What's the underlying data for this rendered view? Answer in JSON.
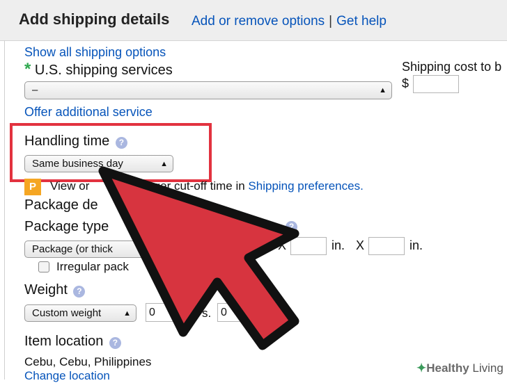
{
  "header": {
    "title": "Add shipping details",
    "link_add_remove": "Add or remove options",
    "separator": "|",
    "link_help": "Get help"
  },
  "shipping": {
    "show_all_link": "Show all shipping options",
    "required_marker": "*",
    "us_services_label": "U.S. shipping services",
    "service_select_value": "–",
    "offer_additional_link": "Offer additional service",
    "cost_label": "Shipping cost to b",
    "currency_symbol": "$"
  },
  "handling": {
    "label": "Handling time",
    "help_glyph": "?",
    "select_value": "Same business day"
  },
  "notice": {
    "badge": "P",
    "text_a": "View or",
    "text_b": "rger cut-off time in",
    "link": "Shipping preferences."
  },
  "package": {
    "details_label": "Package de",
    "type_label": "Package type",
    "type_select_value": "Package (or thick",
    "x1": "X",
    "unit1": "in.",
    "x2": "X",
    "unit2": "in.",
    "irregular_label": "Irregular pack"
  },
  "weight": {
    "label": "Weight",
    "select_value": "Custom weight",
    "field1_value": "0",
    "field2_value": "0",
    "unit_fragment": "s."
  },
  "location": {
    "label": "Item location",
    "value": "Cebu, Cebu, Philippines",
    "change_link": "Change location"
  },
  "watermark": {
    "brand_a": "Healthy",
    "brand_b": " Living"
  },
  "colors": {
    "link": "#0654ba",
    "highlight": "#e2323f",
    "arrow_fill": "#d7343f",
    "required": "#2fa84f",
    "badge": "#f5a623"
  }
}
